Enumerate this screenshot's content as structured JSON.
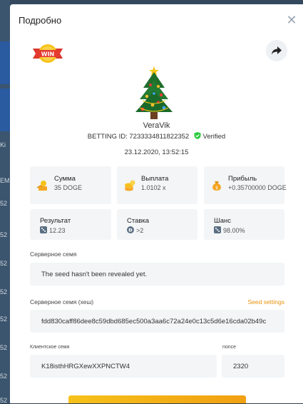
{
  "background_hints": {
    "left_labels": [
      "Ki",
      "EM",
      "52",
      "52",
      "52",
      "52",
      "52",
      "52",
      "52",
      "52"
    ]
  },
  "modal": {
    "title": "Подробно",
    "close_icon": "close-icon",
    "share_icon": "share-arrow-icon",
    "badge_text": "WIN",
    "avatar_icon": "christmas-tree-icon",
    "username": "VeraVik",
    "betting_label": "BETTING ID:",
    "betting_id": "7233334811822352",
    "verified_label": "Verified",
    "datetime": "23.12.2020, 13:52:15",
    "stats_top": [
      {
        "label": "Сумма",
        "value": "35 DOGE",
        "icon": "coins-icon"
      },
      {
        "label": "Выплата",
        "value": "1.0102 x",
        "icon": "coin-stack-icon"
      },
      {
        "label": "Прибыль",
        "value": "+0.35700000 DOGE",
        "icon": "money-bag-icon"
      }
    ],
    "stats_bottom": [
      {
        "label": "Результат",
        "value": "12.23",
        "icon": "dice-icon"
      },
      {
        "label": "Ставка",
        "value": ">2",
        "icon": "doge-coin-icon"
      },
      {
        "label": "Шанс",
        "value": "98.00%",
        "icon": "dice-icon"
      }
    ],
    "server_seed_label": "Серверное семя",
    "server_seed_value": "The seed hasn't been revealed yet.",
    "server_hash_label": "Серверное семя (хеш)",
    "seed_settings_label": "Seed settings",
    "server_hash_value": "fdd830caff86dee8c59dbd685ec500a3aa6c72a24e0c13c5d6e16cda02b49c",
    "client_seed_label": "Клиентское семя",
    "client_seed_value": "K18isthHRGXewXXPNCTW4",
    "nonce_label": "nonce",
    "nonce_value": "2320"
  },
  "colors": {
    "accent": "#f1a012",
    "verified": "#2ecc40",
    "card_bg": "#f3f5f7"
  }
}
